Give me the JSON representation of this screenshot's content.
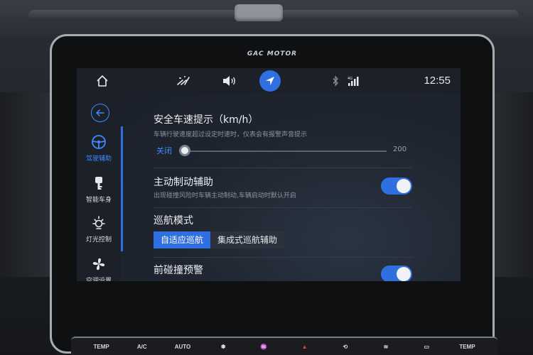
{
  "brand": "GAC MOTOR",
  "status_bar": {
    "clock": "12:55",
    "signal_label": "4G",
    "icons": [
      "home-icon",
      "wiper-icon",
      "volume-icon",
      "navigation-icon",
      "bluetooth-icon",
      "signal-icon"
    ]
  },
  "sidebar": {
    "back_icon": "back-arrow-icon",
    "items": [
      {
        "label": "驾驶辅助",
        "icon": "steering-wheel-icon",
        "active": true
      },
      {
        "label": "智能车身",
        "icon": "car-key-icon",
        "active": false
      },
      {
        "label": "灯光控制",
        "icon": "light-icon",
        "active": false
      },
      {
        "label": "空调设置",
        "icon": "fan-icon",
        "active": false
      }
    ]
  },
  "settings": {
    "speed_alert": {
      "title": "安全车速提示（km/h）",
      "description": "车辆行驶速度超过设定时速时，仪表会有报警声音提示",
      "min_label": "关闭",
      "max_label": "200",
      "value_fraction": 0.0
    },
    "active_brake": {
      "title": "主动制动辅助",
      "description": "出现碰撞风险时车辆主动制动,车辆启动时默认开启",
      "enabled": true
    },
    "cruise_mode": {
      "title": "巡航模式",
      "options": [
        "自适应巡航",
        "集成式巡航辅助"
      ],
      "selected_index": 0
    },
    "collision_warning": {
      "title": "前碰撞预警",
      "enabled": true
    }
  },
  "console": {
    "buttons": [
      "TEMP",
      "A/C",
      "AUTO",
      "",
      "",
      "",
      "",
      "",
      "",
      "TEMP"
    ]
  },
  "colors": {
    "accent": "#2f6fe0",
    "active_text": "#3d8bff",
    "screen_bg": "#1b2029"
  }
}
